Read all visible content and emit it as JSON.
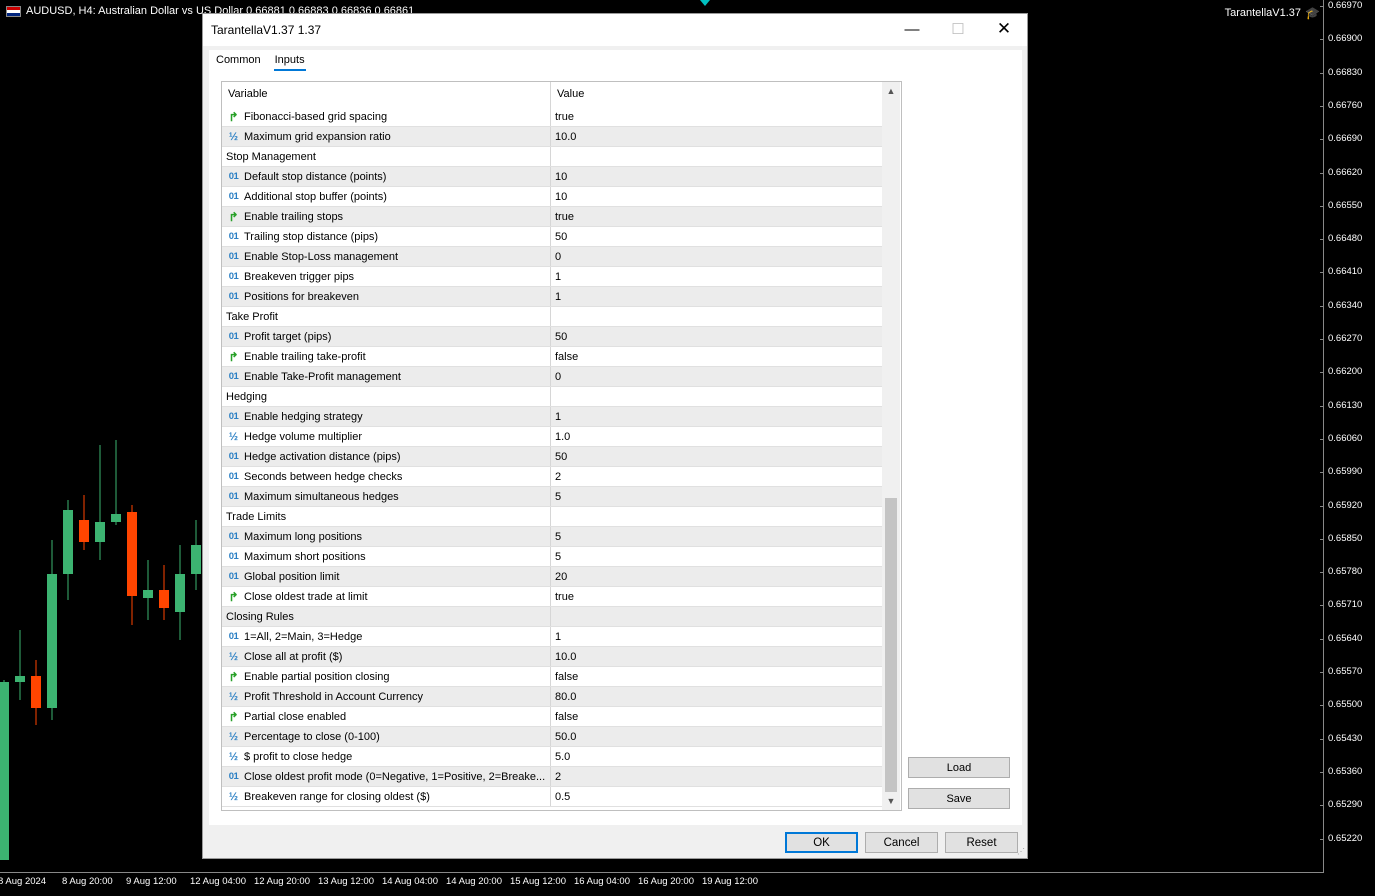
{
  "chart": {
    "title": "AUDUSD, H4:  Australian Dollar vs US Dollar  0.66881 0.66883 0.66836 0.66861",
    "expert_label": "TarantellaV1.37",
    "price_labels": [
      "0.66970",
      "0.66900",
      "0.66830",
      "0.66760",
      "0.66690",
      "0.66620",
      "0.66550",
      "0.66480",
      "0.66410",
      "0.66340",
      "0.66270",
      "0.66200",
      "0.66130",
      "0.66060",
      "0.65990",
      "0.65920",
      "0.65850",
      "0.65780",
      "0.65710",
      "0.65640",
      "0.65570",
      "0.65500",
      "0.65430",
      "0.65360",
      "0.65290",
      "0.65220"
    ],
    "time_labels": [
      "8 Aug 2024",
      "8 Aug 20:00",
      "9 Aug 12:00",
      "12 Aug 04:00",
      "12 Aug 20:00",
      "13 Aug 12:00",
      "14 Aug 04:00",
      "14 Aug 20:00",
      "15 Aug 12:00",
      "16 Aug 04:00",
      "16 Aug 20:00",
      "19 Aug 12:00"
    ],
    "bull_color": "#3cb371",
    "bear_color": "#ff4500"
  },
  "dialog": {
    "title": "TarantellaV1.37 1.37",
    "tabs": [
      "Common",
      "Inputs"
    ],
    "active_tab": "Inputs",
    "columns": {
      "variable": "Variable",
      "value": "Value"
    },
    "rows": [
      {
        "type": "bool",
        "name": "Fibonacci-based grid spacing",
        "value": "true"
      },
      {
        "type": "dbl",
        "name": "Maximum grid expansion ratio",
        "value": "10.0"
      },
      {
        "type": "section",
        "name": "Stop Management",
        "value": ""
      },
      {
        "type": "int",
        "name": "Default stop distance (points)",
        "value": "10"
      },
      {
        "type": "int",
        "name": "Additional stop buffer (points)",
        "value": "10"
      },
      {
        "type": "bool",
        "name": "Enable trailing stops",
        "value": "true"
      },
      {
        "type": "int",
        "name": "Trailing stop distance (pips)",
        "value": "50"
      },
      {
        "type": "int",
        "name": "Enable Stop-Loss management",
        "value": "0"
      },
      {
        "type": "int",
        "name": "Breakeven trigger pips",
        "value": "1"
      },
      {
        "type": "int",
        "name": "Positions for breakeven",
        "value": "1"
      },
      {
        "type": "section",
        "name": "Take Profit",
        "value": ""
      },
      {
        "type": "int",
        "name": "Profit target (pips)",
        "value": "50"
      },
      {
        "type": "bool",
        "name": "Enable trailing take-profit",
        "value": "false"
      },
      {
        "type": "int",
        "name": "Enable Take-Profit management",
        "value": "0"
      },
      {
        "type": "section",
        "name": "Hedging",
        "value": ""
      },
      {
        "type": "int",
        "name": "Enable hedging strategy",
        "value": "1"
      },
      {
        "type": "dbl",
        "name": "Hedge volume multiplier",
        "value": "1.0"
      },
      {
        "type": "int",
        "name": "Hedge activation distance (pips)",
        "value": "50"
      },
      {
        "type": "int",
        "name": "Seconds between hedge checks",
        "value": "2"
      },
      {
        "type": "int",
        "name": "Maximum simultaneous hedges",
        "value": "5"
      },
      {
        "type": "section",
        "name": "Trade Limits",
        "value": ""
      },
      {
        "type": "int",
        "name": "Maximum long positions",
        "value": "5"
      },
      {
        "type": "int",
        "name": "Maximum short positions",
        "value": "5"
      },
      {
        "type": "int",
        "name": "Global position limit",
        "value": "20"
      },
      {
        "type": "bool",
        "name": "Close oldest trade at limit",
        "value": "true"
      },
      {
        "type": "section",
        "name": "Closing Rules",
        "value": ""
      },
      {
        "type": "int",
        "name": " 1=All, 2=Main, 3=Hedge",
        "value": "1"
      },
      {
        "type": "dbl",
        "name": "Close all at profit ($)",
        "value": "10.0"
      },
      {
        "type": "bool",
        "name": "Enable partial position closing",
        "value": "false"
      },
      {
        "type": "dbl",
        "name": "Profit Threshold in Account Currency",
        "value": "80.0"
      },
      {
        "type": "bool",
        "name": "Partial close enabled",
        "value": "false"
      },
      {
        "type": "dbl",
        "name": "Percentage to close (0-100)",
        "value": "50.0"
      },
      {
        "type": "dbl",
        "name": "$ profit to close hedge",
        "value": "5.0"
      },
      {
        "type": "int",
        "name": "Close oldest profit mode (0=Negative, 1=Positive, 2=Breake...",
        "value": "2"
      },
      {
        "type": "dbl",
        "name": "Breakeven range for closing oldest ($)",
        "value": "0.5"
      }
    ],
    "buttons": {
      "load": "Load",
      "save": "Save",
      "ok": "OK",
      "cancel": "Cancel",
      "reset": "Reset"
    },
    "icons": {
      "int": "01",
      "bool": "↱",
      "dbl": "½"
    }
  }
}
